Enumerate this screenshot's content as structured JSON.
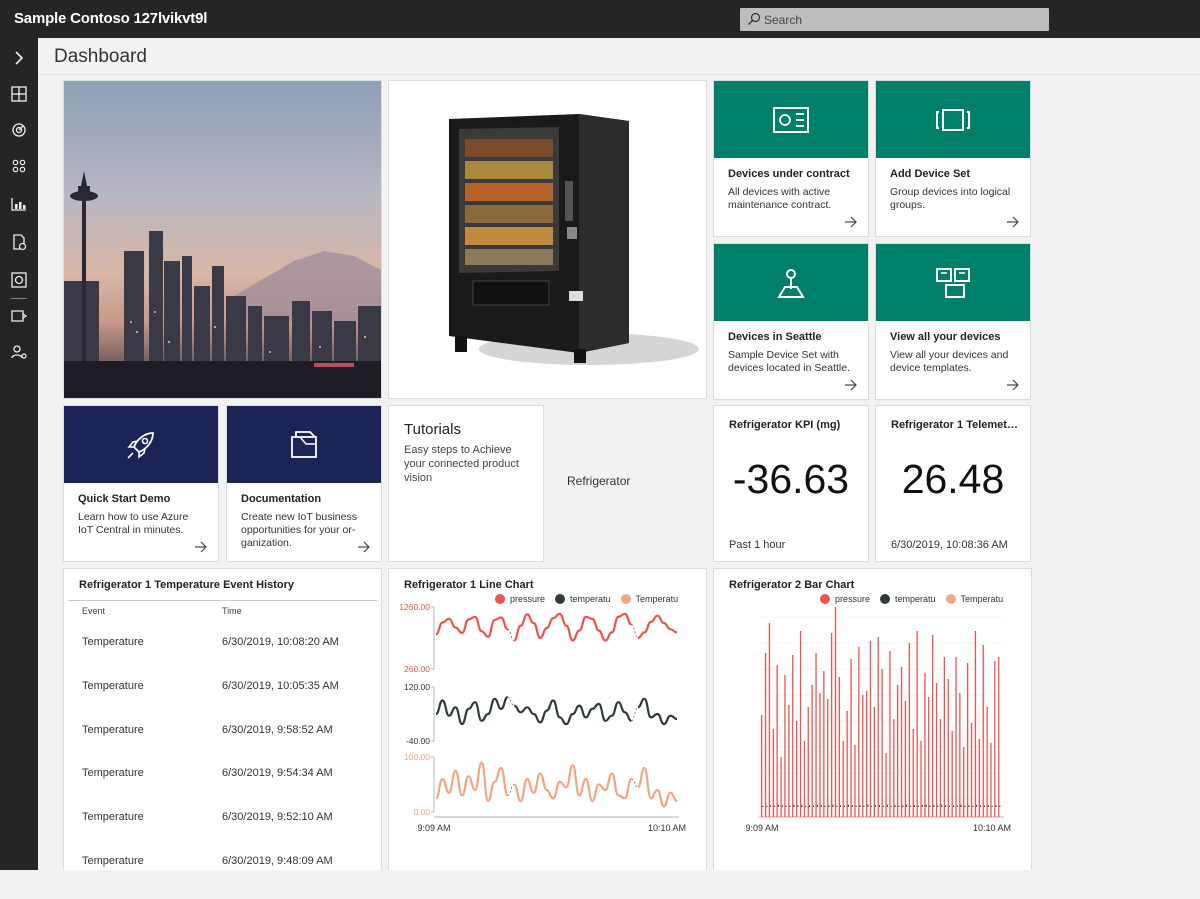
{
  "app": {
    "title": "Sample Contoso 127lvikvt9l"
  },
  "search": {
    "placeholder": "Search"
  },
  "page": {
    "title": "Dashboard"
  },
  "rail": {
    "items": [
      {
        "icon": "chevron-right-icon"
      },
      {
        "icon": "dashboard-icon"
      },
      {
        "icon": "devices-icon"
      },
      {
        "icon": "device-sets-icon"
      },
      {
        "icon": "analytics-icon"
      },
      {
        "icon": "jobs-icon"
      },
      {
        "icon": "application-builder-icon"
      },
      {
        "icon": "device-templates-icon"
      },
      {
        "icon": "administration-icon"
      }
    ]
  },
  "tiles": {
    "devices_under_contract": {
      "title": "Devices under contract",
      "desc": "All devices with active maintenance contract."
    },
    "add_device_set": {
      "title": "Add Device Set",
      "desc": "Group devices into logical groups."
    },
    "devices_in_seattle": {
      "title": "Devices in Seattle",
      "desc": "Sample Device Set with devices located in Seattle."
    },
    "view_all_devices": {
      "title": "View all your devices",
      "desc": "View all your devices and device templates."
    },
    "quick_start": {
      "title": "Quick Start Demo",
      "desc": "Learn how to use Azure IoT Central in minutes."
    },
    "documentation": {
      "title": "Documentation",
      "desc": "Create new IoT business opportunities for your or-ganization."
    },
    "tutorials": {
      "title": "Tutorials",
      "desc": "Easy steps to Achieve your connected product vision"
    },
    "refrigerator_label": "Refrigerator"
  },
  "kpi": [
    {
      "title": "Refrigerator KPI (mg)",
      "value": "-36.63",
      "sub": "Past 1 hour"
    },
    {
      "title": "Refrigerator 1 Telemetry...",
      "value": "26.48",
      "sub": "6/30/2019, 10:08:36 AM"
    }
  ],
  "event_history": {
    "title": "Refrigerator 1 Temperature Event History",
    "columns": [
      "Event",
      "Time"
    ],
    "rows": [
      [
        "Temperature",
        "6/30/2019, 10:08:20 AM"
      ],
      [
        "Temperature",
        "6/30/2019, 10:05:35 AM"
      ],
      [
        "Temperature",
        "6/30/2019, 9:58:52 AM"
      ],
      [
        "Temperature",
        "6/30/2019, 9:54:34 AM"
      ],
      [
        "Temperature",
        "6/30/2019, 9:52:10 AM"
      ],
      [
        "Temperature",
        "6/30/2019, 9:48:09 AM"
      ]
    ]
  },
  "colors": {
    "pressure": "#ef5350",
    "temperature": "#2f3b3b",
    "temperature2": "#f4a582",
    "teal": "#00806a",
    "navy": "#1b2357"
  },
  "chart_data": [
    {
      "type": "line",
      "title": "Refrigerator 1 Line Chart",
      "legend": [
        "pressure",
        "temperatu",
        "Temperatu"
      ],
      "x_ticks": [
        "9:09 AM",
        "10:10 AM"
      ],
      "panels": [
        {
          "series": "pressure",
          "ylim": [
            260,
            1260
          ],
          "y_ticks": [
            "1260.00",
            "260.00"
          ],
          "values": [
            820,
            1010,
            1070,
            930,
            840,
            1060,
            1100,
            870,
            780,
            1050,
            1090,
            900,
            720,
            960,
            1140,
            1000,
            760,
            920,
            1080,
            1150,
            960,
            720,
            880,
            1100,
            1070,
            880,
            720,
            850,
            1100,
            1150,
            980,
            760,
            850,
            1020,
            1120,
            1000,
            900,
            850
          ]
        },
        {
          "series": "temperatu",
          "ylim": [
            -40,
            120
          ],
          "y_ticks": [
            "120.00",
            "-40.00"
          ],
          "values": [
            40,
            80,
            35,
            60,
            10,
            55,
            75,
            20,
            40,
            85,
            55,
            90,
            65,
            45,
            60,
            40,
            15,
            50,
            80,
            30,
            10,
            40,
            65,
            30,
            55,
            70,
            20,
            35,
            75,
            45,
            20,
            60,
            85,
            30,
            40,
            10,
            35,
            25
          ]
        },
        {
          "series": "Temperatu",
          "ylim": [
            0,
            100
          ],
          "y_ticks": [
            "100.00",
            "0.00"
          ],
          "values": [
            25,
            60,
            35,
            75,
            30,
            65,
            40,
            90,
            20,
            55,
            80,
            30,
            50,
            20,
            60,
            35,
            70,
            40,
            25,
            55,
            45,
            85,
            30,
            60,
            20,
            50,
            40,
            70,
            30,
            25,
            60,
            45,
            80,
            25,
            40,
            10,
            35,
            20
          ]
        }
      ]
    },
    {
      "type": "bar",
      "title": "Refrigerator 2 Bar Chart",
      "legend": [
        "pressure",
        "temperatu",
        "Temperatu"
      ],
      "x_ticks": [
        "9:09 AM",
        "10:10 AM"
      ],
      "series": [
        {
          "name": "pressure",
          "values": [
            0.51,
            0.82,
            0.97,
            0.44,
            0.76,
            0.3,
            0.71,
            0.56,
            0.81,
            0.48,
            0.93,
            0.38,
            0.55,
            0.66,
            0.82,
            0.62,
            0.73,
            0.59,
            0.92,
            1.05,
            0.7,
            0.38,
            0.53,
            0.79,
            0.36,
            0.85,
            0.61,
            0.63,
            0.88,
            0.55,
            0.9,
            0.74,
            0.32,
            0.83,
            0.49,
            0.66,
            0.75,
            0.58,
            0.87,
            0.44,
            0.93,
            0.38,
            0.72,
            0.6,
            0.91,
            0.67,
            0.49,
            0.8,
            0.69,
            0.43,
            0.8,
            0.62,
            0.35,
            0.77,
            0.47,
            0.93,
            0.39,
            0.86,
            0.55,
            0.37,
            0.78,
            0.8
          ]
        },
        {
          "name": "temperatu",
          "values": [
            0.02,
            0.02,
            0.03,
            0.02,
            0.04,
            0.03,
            0.02,
            0.02,
            0.04,
            0.03,
            0.04,
            0.02,
            0.03,
            0.02,
            0.04,
            0.03,
            0.02,
            0.03,
            0.04,
            0.02,
            0.03,
            0.02,
            0.04,
            0.03,
            0.02,
            0.03,
            0.02,
            0.04,
            0.02,
            0.03,
            0.03,
            0.02,
            0.04,
            0.02,
            0.03,
            0.02,
            0.03,
            0.04,
            0.02,
            0.03,
            0.02,
            0.03,
            0.04,
            0.02,
            0.03,
            0.02,
            0.04,
            0.03,
            0.02,
            0.03,
            0.02,
            0.04,
            0.02,
            0.03,
            0.02,
            0.04,
            0.03,
            0.02,
            0.03,
            0.02,
            0.03,
            0.02
          ]
        },
        {
          "name": "Temperatu",
          "values": [
            0.01,
            0.02,
            0.01,
            0.02,
            0.02,
            0.01,
            0.02,
            0.01,
            0.02,
            0.01,
            0.02,
            0.02,
            0.01,
            0.02,
            0.01,
            0.02,
            0.02,
            0.01,
            0.02,
            0.01,
            0.02,
            0.01,
            0.02,
            0.02,
            0.01,
            0.02,
            0.01,
            0.02,
            0.01,
            0.02,
            0.02,
            0.01,
            0.02,
            0.01,
            0.02,
            0.01,
            0.02,
            0.02,
            0.01,
            0.02,
            0.01,
            0.02,
            0.01,
            0.02,
            0.02,
            0.01,
            0.02,
            0.01,
            0.02,
            0.01,
            0.02,
            0.02,
            0.01,
            0.02,
            0.01,
            0.02,
            0.01,
            0.02,
            0.02,
            0.01,
            0.02,
            0.01
          ]
        }
      ]
    }
  ]
}
